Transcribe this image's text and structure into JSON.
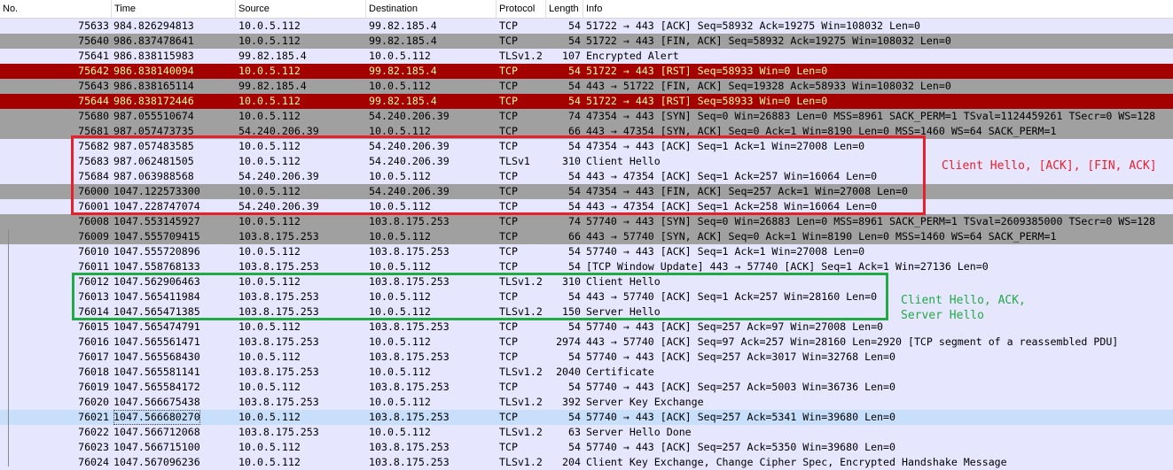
{
  "columns": {
    "no": "No.",
    "time": "Time",
    "source": "Source",
    "destination": "Destination",
    "protocol": "Protocol",
    "length": "Length",
    "info": "Info"
  },
  "colors": {
    "tcp": "#e7e6ff",
    "bad_tcp": "#a40000",
    "bad_tcp_text": "#fffc9c",
    "fin_syn": "#a0a0a0",
    "selected": "#c7dffb",
    "annotation_red": "#e8202a",
    "annotation_green": "#22aa44"
  },
  "packets": [
    {
      "no": "75633",
      "time": "984.826294813",
      "src": "10.0.5.112",
      "dst": "99.82.185.4",
      "proto": "TCP",
      "len": "54",
      "info": "51722 → 443 [ACK] Seq=58932 Ack=19275 Win=108032 Len=0",
      "style": "tcp"
    },
    {
      "no": "75640",
      "time": "986.837478641",
      "src": "10.0.5.112",
      "dst": "99.82.185.4",
      "proto": "TCP",
      "len": "54",
      "info": "51722 → 443 [FIN, ACK] Seq=58932 Ack=19275 Win=108032 Len=0",
      "style": "fin"
    },
    {
      "no": "75641",
      "time": "986.838115983",
      "src": "99.82.185.4",
      "dst": "10.0.5.112",
      "proto": "TLSv1.2",
      "len": "107",
      "info": "Encrypted Alert",
      "style": "tcp"
    },
    {
      "no": "75642",
      "time": "986.838140094",
      "src": "10.0.5.112",
      "dst": "99.82.185.4",
      "proto": "TCP",
      "len": "54",
      "info": "51722 → 443 [RST] Seq=58933 Win=0 Len=0",
      "style": "bad"
    },
    {
      "no": "75643",
      "time": "986.838165114",
      "src": "99.82.185.4",
      "dst": "10.0.5.112",
      "proto": "TCP",
      "len": "54",
      "info": "443 → 51722 [FIN, ACK] Seq=19328 Ack=58933 Win=108032 Len=0",
      "style": "fin"
    },
    {
      "no": "75644",
      "time": "986.838172446",
      "src": "10.0.5.112",
      "dst": "99.82.185.4",
      "proto": "TCP",
      "len": "54",
      "info": "51722 → 443 [RST] Seq=58933 Win=0 Len=0",
      "style": "bad"
    },
    {
      "no": "75680",
      "time": "987.055510674",
      "src": "10.0.5.112",
      "dst": "54.240.206.39",
      "proto": "TCP",
      "len": "74",
      "info": "47354 → 443 [SYN] Seq=0 Win=26883 Len=0 MSS=8961 SACK_PERM=1 TSval=1124459261 TSecr=0 WS=128",
      "style": "fin"
    },
    {
      "no": "75681",
      "time": "987.057473735",
      "src": "54.240.206.39",
      "dst": "10.0.5.112",
      "proto": "TCP",
      "len": "66",
      "info": "443 → 47354 [SYN, ACK] Seq=0 Ack=1 Win=8190 Len=0 MSS=1460 WS=64 SACK_PERM=1",
      "style": "fin"
    },
    {
      "no": "75682",
      "time": "987.057483585",
      "src": "10.0.5.112",
      "dst": "54.240.206.39",
      "proto": "TCP",
      "len": "54",
      "info": "47354 → 443 [ACK] Seq=1 Ack=1 Win=27008 Len=0",
      "style": "tcp"
    },
    {
      "no": "75683",
      "time": "987.062481505",
      "src": "10.0.5.112",
      "dst": "54.240.206.39",
      "proto": "TLSv1",
      "len": "310",
      "info": "Client Hello",
      "style": "tcp"
    },
    {
      "no": "75684",
      "time": "987.063988568",
      "src": "54.240.206.39",
      "dst": "10.0.5.112",
      "proto": "TCP",
      "len": "54",
      "info": "443 → 47354 [ACK] Seq=1 Ack=257 Win=16064 Len=0",
      "style": "tcp"
    },
    {
      "no": "76000",
      "time": "1047.122573300",
      "src": "10.0.5.112",
      "dst": "54.240.206.39",
      "proto": "TCP",
      "len": "54",
      "info": "47354 → 443 [FIN, ACK] Seq=257 Ack=1 Win=27008 Len=0",
      "style": "fin"
    },
    {
      "no": "76001",
      "time": "1047.228747074",
      "src": "54.240.206.39",
      "dst": "10.0.5.112",
      "proto": "TCP",
      "len": "54",
      "info": "443 → 47354 [ACK] Seq=1 Ack=258 Win=16064 Len=0",
      "style": "tcp"
    },
    {
      "no": "76008",
      "time": "1047.553145927",
      "src": "10.0.5.112",
      "dst": "103.8.175.253",
      "proto": "TCP",
      "len": "74",
      "info": "57740 → 443 [SYN] Seq=0 Win=26883 Len=0 MSS=8961 SACK_PERM=1 TSval=2609385000 TSecr=0 WS=128",
      "style": "fin"
    },
    {
      "no": "76009",
      "time": "1047.555709415",
      "src": "103.8.175.253",
      "dst": "10.0.5.112",
      "proto": "TCP",
      "len": "66",
      "info": "443 → 57740 [SYN, ACK] Seq=0 Ack=1 Win=8190 Len=0 MSS=1460 WS=64 SACK_PERM=1",
      "style": "fin"
    },
    {
      "no": "76010",
      "time": "1047.555720896",
      "src": "10.0.5.112",
      "dst": "103.8.175.253",
      "proto": "TCP",
      "len": "54",
      "info": "57740 → 443 [ACK] Seq=1 Ack=1 Win=27008 Len=0",
      "style": "tcp"
    },
    {
      "no": "76011",
      "time": "1047.558768133",
      "src": "103.8.175.253",
      "dst": "10.0.5.112",
      "proto": "TCP",
      "len": "54",
      "info": "[TCP Window Update] 443 → 57740 [ACK] Seq=1 Ack=1 Win=27136 Len=0",
      "style": "tcp"
    },
    {
      "no": "76012",
      "time": "1047.562906463",
      "src": "10.0.5.112",
      "dst": "103.8.175.253",
      "proto": "TLSv1.2",
      "len": "310",
      "info": "Client Hello",
      "style": "tcp"
    },
    {
      "no": "76013",
      "time": "1047.565411984",
      "src": "103.8.175.253",
      "dst": "10.0.5.112",
      "proto": "TCP",
      "len": "54",
      "info": "443 → 57740 [ACK] Seq=1 Ack=257 Win=28160 Len=0",
      "style": "tcp"
    },
    {
      "no": "76014",
      "time": "1047.565471385",
      "src": "103.8.175.253",
      "dst": "10.0.5.112",
      "proto": "TLSv1.2",
      "len": "150",
      "info": "Server Hello",
      "style": "tcp"
    },
    {
      "no": "76015",
      "time": "1047.565474791",
      "src": "10.0.5.112",
      "dst": "103.8.175.253",
      "proto": "TCP",
      "len": "54",
      "info": "57740 → 443 [ACK] Seq=257 Ack=97 Win=27008 Len=0",
      "style": "tcp"
    },
    {
      "no": "76016",
      "time": "1047.565561471",
      "src": "103.8.175.253",
      "dst": "10.0.5.112",
      "proto": "TCP",
      "len": "2974",
      "info": "443 → 57740 [ACK] Seq=97 Ack=257 Win=28160 Len=2920 [TCP segment of a reassembled PDU]",
      "style": "tcp"
    },
    {
      "no": "76017",
      "time": "1047.565568430",
      "src": "10.0.5.112",
      "dst": "103.8.175.253",
      "proto": "TCP",
      "len": "54",
      "info": "57740 → 443 [ACK] Seq=257 Ack=3017 Win=32768 Len=0",
      "style": "tcp"
    },
    {
      "no": "76018",
      "time": "1047.565581141",
      "src": "103.8.175.253",
      "dst": "10.0.5.112",
      "proto": "TLSv1.2",
      "len": "2040",
      "info": "Certificate",
      "style": "tcp"
    },
    {
      "no": "76019",
      "time": "1047.565584172",
      "src": "10.0.5.112",
      "dst": "103.8.175.253",
      "proto": "TCP",
      "len": "54",
      "info": "57740 → 443 [ACK] Seq=257 Ack=5003 Win=36736 Len=0",
      "style": "tcp"
    },
    {
      "no": "76020",
      "time": "1047.566675438",
      "src": "103.8.175.253",
      "dst": "10.0.5.112",
      "proto": "TLSv1.2",
      "len": "392",
      "info": "Server Key Exchange",
      "style": "tcp"
    },
    {
      "no": "76021",
      "time": "1047.566680270",
      "src": "10.0.5.112",
      "dst": "103.8.175.253",
      "proto": "TCP",
      "len": "54",
      "info": "57740 → 443 [ACK] Seq=257 Ack=5341 Win=39680 Len=0",
      "style": "selected"
    },
    {
      "no": "76022",
      "time": "1047.566712068",
      "src": "103.8.175.253",
      "dst": "10.0.5.112",
      "proto": "TLSv1.2",
      "len": "63",
      "info": "Server Hello Done",
      "style": "tcp"
    },
    {
      "no": "76023",
      "time": "1047.566715100",
      "src": "10.0.5.112",
      "dst": "103.8.175.253",
      "proto": "TCP",
      "len": "54",
      "info": "57740 → 443 [ACK] Seq=257 Ack=5350 Win=39680 Len=0",
      "style": "tcp"
    },
    {
      "no": "76024",
      "time": "1047.567096236",
      "src": "10.0.5.112",
      "dst": "103.8.175.253",
      "proto": "TLSv1.2",
      "len": "204",
      "info": "Client Key Exchange, Change Cipher Spec, Encrypted Handshake Message",
      "style": "tcp"
    }
  ],
  "annotations": {
    "red_text": "Client Hello, [ACK], [FIN, ACK]",
    "green_line1": "Client Hello, ACK,",
    "green_line2": "Server Hello"
  }
}
